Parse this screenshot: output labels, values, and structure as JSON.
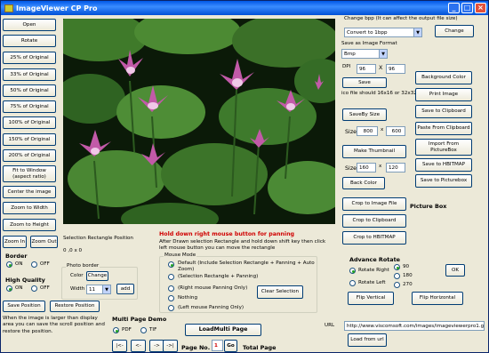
{
  "title": "ImageViewer CP Pro",
  "left_buttons": [
    "Open",
    "Rotate",
    "25% of Original",
    "33% of Original",
    "50% of Original",
    "75% of Original",
    "100% of Original",
    "150% of Original",
    "200% of Original",
    "Fit to Window (aspect ratio)",
    "Center the image",
    "Zoom to Width",
    "Zoom to Height"
  ],
  "zoom_in": "Zoom In",
  "zoom_out": "Zoom Out",
  "selection_label": "Selection Rectangle Position",
  "selection_value": "0 ,0 x 0",
  "border_label": "Border",
  "on": "ON",
  "off": "OFF",
  "photo_border": "Photo border",
  "color_label": "Color",
  "change": "Change",
  "width_label": "Width",
  "width_value": "11",
  "add": "add",
  "high_quality": "High Quality",
  "save_position": "Save Position",
  "restore_position": "Restore Position",
  "scroll_note": "When the image is larger than display area you can save the scroll position and restore the position.",
  "panning_hint": "Hold down right mouse button for panning",
  "drawn_hint": "After Drawn selection Rectangle and hold down shift key then click left mouse button you can move the rectangle",
  "mouse_mode": {
    "title": "Mouse Mode",
    "options": [
      "Default (Include Selection Rectangle + Panning + Auto Zoom)",
      "(Selection Rectangle + Panning)",
      "(Right mouse Panning Only)",
      "Nothing",
      "(Left mouse Panning Only)"
    ],
    "clear": "Clear Selection"
  },
  "multipage": {
    "title": "Multi Page Demo",
    "pdf": "PDF",
    "tif": "TIF",
    "load": "LoadMulti Page",
    "nav": [
      "|<-",
      "<-",
      "->",
      "->|"
    ],
    "page_no": "Page No.",
    "page_value": "1",
    "go": "Go",
    "total": "Total Page"
  },
  "bpp_title": "Change bpp (It can affect the output file size)",
  "bpp_value": "Convert to 1bpp",
  "bpp_change": "Change",
  "save_format_label": "Save as Image Format",
  "format_value": "Bmp",
  "dpi_label": "DPI",
  "dpi_x": "96",
  "dpi_x_sep": "X",
  "dpi_y": "96",
  "save": "Save",
  "ico_note": "ico file should 16x16 or 32x32",
  "save_by_size": "SaveBy Size",
  "size_label": "Size",
  "size1_w": "800",
  "size1_h": "600",
  "size_sep": "x",
  "make_thumbnail": "Make Thumbnail",
  "size2_w": "160",
  "size2_h": "120",
  "back_color": "Back Color",
  "crop_image": "Crop to Image File",
  "crop_clipboard": "Crop to Clipboard",
  "crop_hbitmap": "Crop to HBITMAP",
  "right_buttons": [
    "Background Color",
    "Print Image",
    "Save to Clipboard",
    "Paste From Clipboard",
    "Import From PictureBox",
    "Save to HBITMAP",
    "Save to Picturebox"
  ],
  "picture_box": "Picture Box",
  "advance_rotate": "Advance Rotate",
  "rotate_right": "Rotate Right",
  "rotate_left": "Rotate Left",
  "angles": [
    "90",
    "180",
    "270"
  ],
  "ok": "OK",
  "flip_vertical": "Flip Vertical",
  "flip_horizontal": "Flip Horizontal",
  "url_label": "URL",
  "url_value": "http://www.viscomsoft.com/images/imageviewerpro1.gif",
  "load_from_url": "Load from url"
}
